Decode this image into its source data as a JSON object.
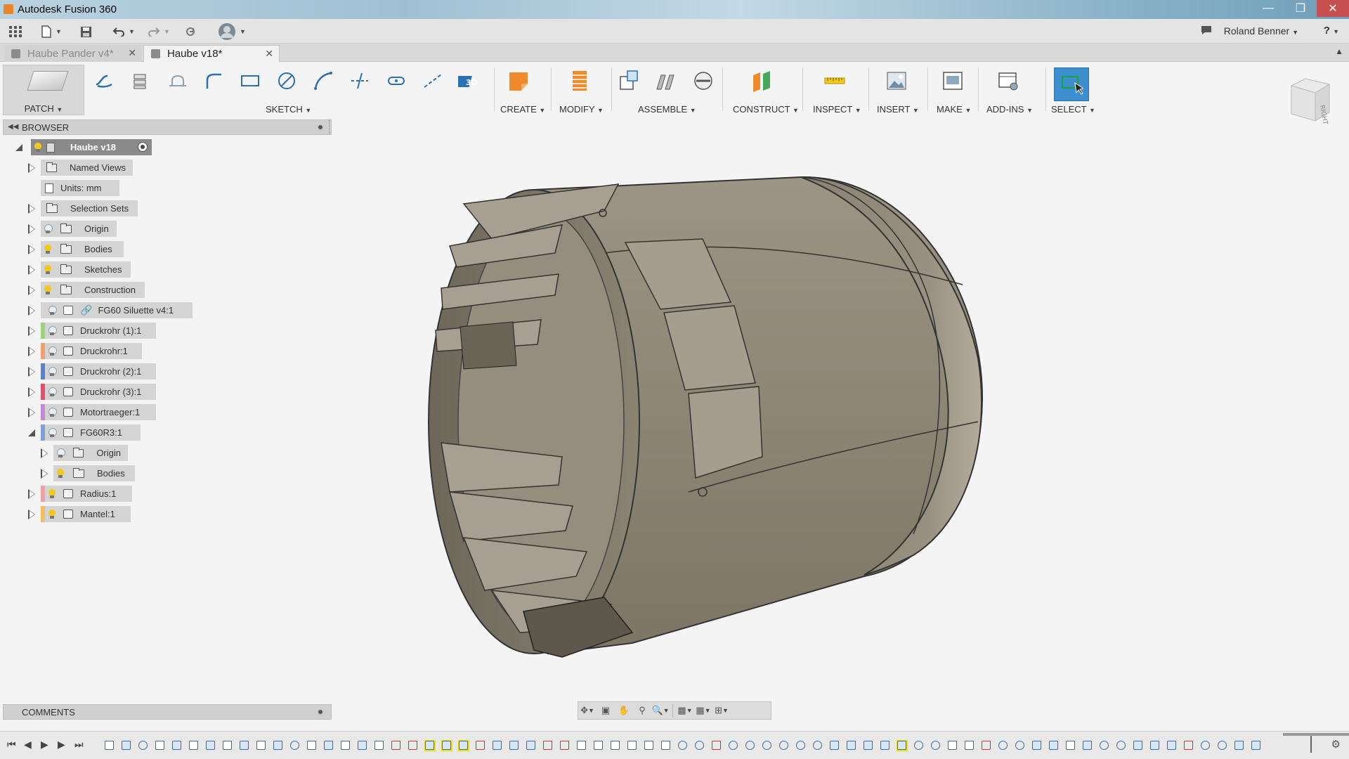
{
  "window": {
    "title": "Autodesk Fusion 360",
    "controls": [
      "minimize-icon",
      "maximize-icon",
      "close-icon"
    ]
  },
  "quick_access": {
    "user_name": "Roland Benner",
    "help_label": "?"
  },
  "tabs": [
    {
      "label": "Haube Pander v4*",
      "active": false
    },
    {
      "label": "Haube v18*",
      "active": true
    }
  ],
  "ribbon": {
    "workspace": "PATCH",
    "groups": {
      "sketch": "SKETCH",
      "create": "CREATE",
      "modify": "MODIFY",
      "assemble": "ASSEMBLE",
      "construct": "CONSTRUCT",
      "inspect": "INSPECT",
      "insert": "INSERT",
      "make": "MAKE",
      "addins": "ADD-INS",
      "select": "SELECT"
    },
    "accent": "#3d8ecf",
    "create_color": "#f08a2b"
  },
  "browser": {
    "title": "BROWSER",
    "root": "Haube v18",
    "items": [
      {
        "label": "Named Views"
      },
      {
        "label": "Units: mm"
      },
      {
        "label": "Selection Sets"
      },
      {
        "label": "Origin"
      },
      {
        "label": "Bodies"
      },
      {
        "label": "Sketches"
      },
      {
        "label": "Construction"
      },
      {
        "label": "FG60 Siluette v4:1"
      },
      {
        "label": "Druckrohr (1):1",
        "color": "#9fd17a"
      },
      {
        "label": "Druckrohr:1",
        "color": "#f0a070"
      },
      {
        "label": "Druckrohr (2):1",
        "color": "#5b7fc9"
      },
      {
        "label": "Druckrohr (3):1",
        "color": "#e0506a"
      },
      {
        "label": "Motortraeger:1",
        "color": "#c48ad8"
      },
      {
        "label": "FG60R3:1",
        "color": "#7fa0d8"
      },
      {
        "label": "Origin"
      },
      {
        "label": "Bodies"
      },
      {
        "label": "Radius:1",
        "color": "#f2a0a8"
      },
      {
        "label": "Mantel:1",
        "color": "#f0c060"
      }
    ]
  },
  "comments": {
    "title": "COMMENTS"
  },
  "viewcube": {
    "face_label": "RIGHT"
  }
}
